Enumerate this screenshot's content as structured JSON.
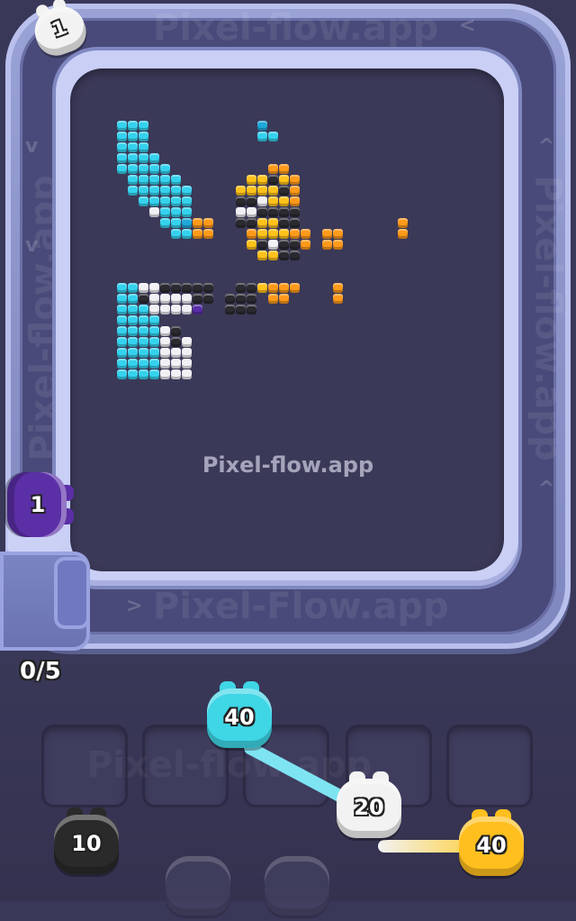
{
  "watermarks": {
    "top": "Pixel-flow.app",
    "left": "Pixel-flow.app",
    "right": "Pixel-flow.app",
    "bottom": "Pixel-Flow.app",
    "center": "Pixel-flow.app",
    "slots": "Pixel-flow.app"
  },
  "queue": {
    "progress_label": "0/5"
  },
  "pigs": {
    "top_left": {
      "count": "1",
      "color": "#f2f2f2"
    },
    "on_belt": {
      "count": "1",
      "color": "#5b2fa6"
    },
    "cyan": {
      "count": "40",
      "color": "#3fd6e6"
    },
    "white": {
      "count": "20",
      "color": "#f2f2f2"
    },
    "yellow": {
      "count": "40",
      "color": "#ffbf1f"
    },
    "black": {
      "count": "10",
      "color": "#2a2a2a"
    }
  },
  "colors": {
    "cyan": "#35d2ee",
    "cyan_dark": "#1fa8d8",
    "white": "#f0f0f5",
    "black": "#2a2a30",
    "yellow": "#ffc21a",
    "orange": "#ff9a1a",
    "purple": "#5a2ea8"
  }
}
